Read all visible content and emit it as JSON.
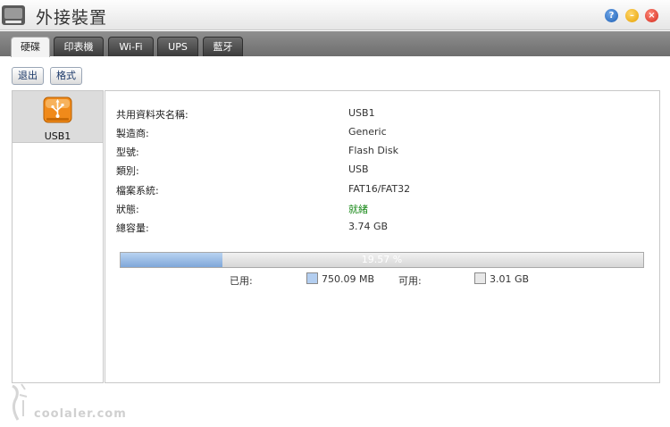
{
  "window": {
    "title": "外接裝置",
    "help_label": "?",
    "minimize_label": "–",
    "close_label": "×"
  },
  "tabs": [
    {
      "label": "硬碟",
      "active": true
    },
    {
      "label": "印表機",
      "active": false
    },
    {
      "label": "Wi-Fi",
      "active": false
    },
    {
      "label": "UPS",
      "active": false
    },
    {
      "label": "藍牙",
      "active": false
    }
  ],
  "toolbar": {
    "eject_label": "退出",
    "format_label": "格式"
  },
  "devices": [
    {
      "label": "USB1",
      "icon": "usb-drive-icon",
      "selected": true
    }
  ],
  "details": [
    {
      "label": "共用資料夾名稱:",
      "value": "USB1",
      "status": "normal"
    },
    {
      "label": "製造商:",
      "value": "Generic",
      "status": "normal"
    },
    {
      "label": "型號:",
      "value": "Flash Disk",
      "status": "normal"
    },
    {
      "label": "類別:",
      "value": "USB",
      "status": "normal"
    },
    {
      "label": "檔案系統:",
      "value": "FAT16/FAT32",
      "status": "normal"
    },
    {
      "label": "狀態:",
      "value": "就緒",
      "status": "ok"
    },
    {
      "label": "總容量:",
      "value": "3.74 GB",
      "status": "normal"
    }
  ],
  "usage": {
    "percent_text": "19.57 %",
    "used_fraction": 0.1957,
    "used_label": "已用:",
    "used_value": "750.09 MB",
    "free_label": "可用:",
    "free_value": "3.01 GB"
  },
  "watermark": {
    "text": "coolaler.com"
  },
  "colors": {
    "status_ok": "#1a8a1a",
    "usb_orange": "#f08a1a",
    "usage_fill": "#7fa7d9"
  }
}
